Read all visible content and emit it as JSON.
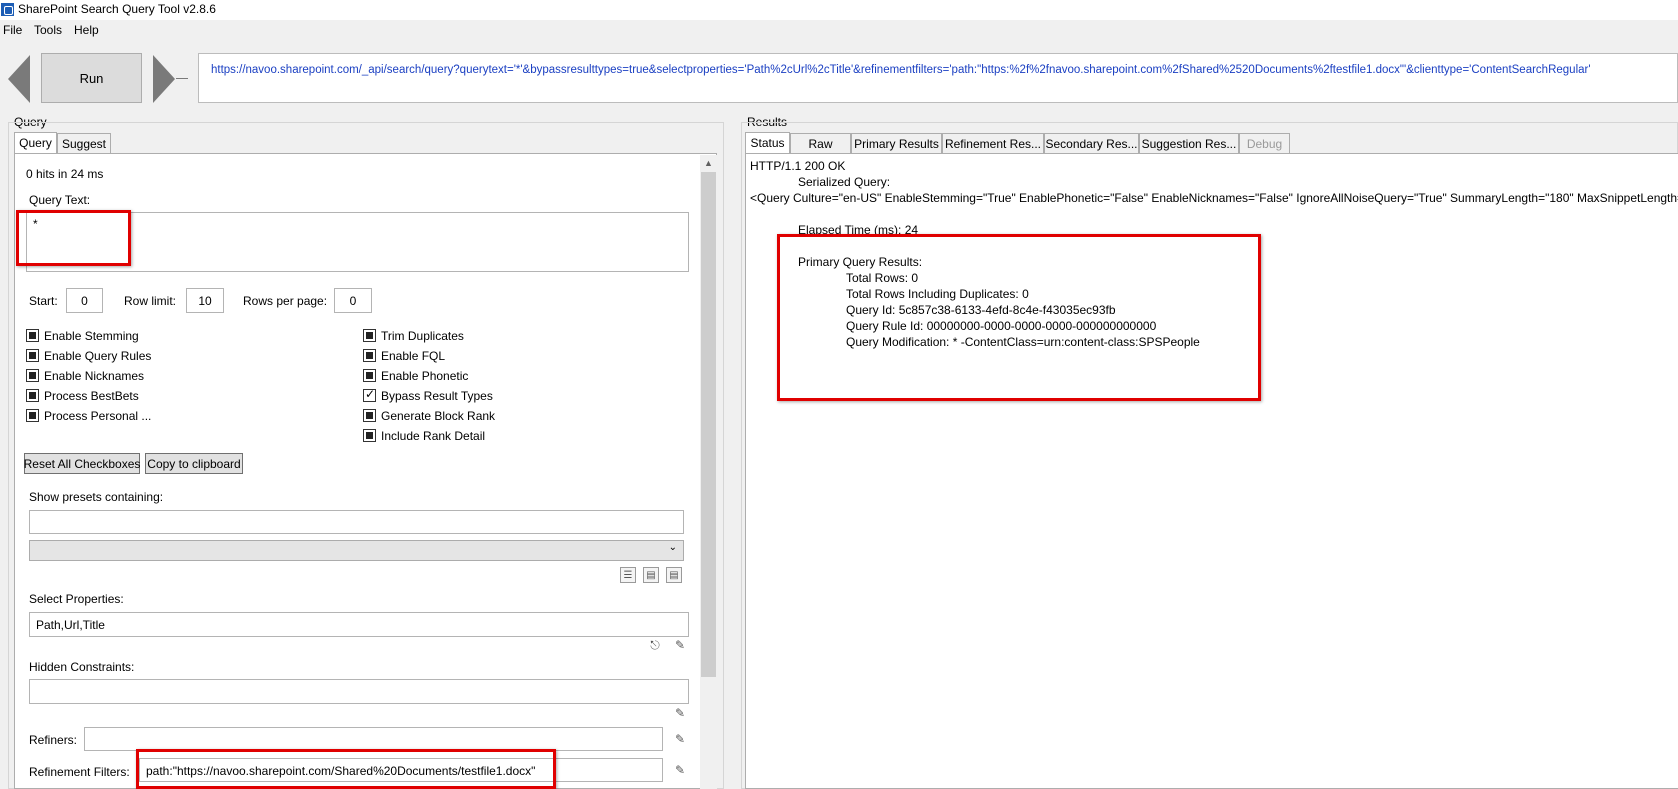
{
  "window": {
    "title": "SharePoint Search Query Tool v2.8.6"
  },
  "menu": {
    "items": [
      "File",
      "Tools",
      "Help"
    ]
  },
  "toolbar": {
    "run_label": "Run",
    "url": "https://navoo.sharepoint.com/_api/search/query?querytext='*'&bypassresulttypes=true&selectproperties='Path%2cUrl%2cTitle'&refinementfilters='path:\"https:%2f%2fnavoo.sharepoint.com%2fShared%2520Documents%2ftestfile1.docx\"'&clienttype='ContentSearchRegular'"
  },
  "query": {
    "group_label": "Query",
    "tabs": [
      {
        "label": "Query",
        "active": true
      },
      {
        "label": "Suggest",
        "active": false
      }
    ],
    "hits_text": "0 hits in 24 ms",
    "query_text_label": "Query Text:",
    "query_text_value": "*",
    "start_label": "Start:",
    "start_value": "0",
    "row_limit_label": "Row limit:",
    "row_limit_value": "10",
    "rows_per_page_label": "Rows per page:",
    "rows_per_page_value": "0",
    "checkboxes_left": [
      {
        "label": "Enable Stemming",
        "state": "indeterminate"
      },
      {
        "label": "Enable Query Rules",
        "state": "indeterminate"
      },
      {
        "label": "Enable Nicknames",
        "state": "indeterminate"
      },
      {
        "label": "Process BestBets",
        "state": "indeterminate"
      },
      {
        "label": "Process Personal ...",
        "state": "indeterminate"
      }
    ],
    "checkboxes_right": [
      {
        "label": "Trim Duplicates",
        "state": "indeterminate"
      },
      {
        "label": "Enable FQL",
        "state": "indeterminate"
      },
      {
        "label": "Enable Phonetic",
        "state": "indeterminate"
      },
      {
        "label": "Bypass Result Types",
        "state": "checked"
      },
      {
        "label": "Generate Block Rank",
        "state": "indeterminate"
      },
      {
        "label": "Include Rank Detail",
        "state": "indeterminate"
      }
    ],
    "reset_button": "Reset All Checkboxes",
    "copy_button": "Copy to clipboard",
    "presets_label": "Show presets containing:",
    "presets_value": "",
    "select_properties_label": "Select Properties:",
    "select_properties_value": "Path,Url,Title",
    "hidden_constraints_label": "Hidden Constraints:",
    "hidden_constraints_value": "",
    "refiners_label": "Refiners:",
    "refiners_value": "",
    "refinement_filters_label": "Refinement Filters:",
    "refinement_filters_value": "path:\"https://navoo.sharepoint.com/Shared%20Documents/testfile1.docx\""
  },
  "results": {
    "group_label": "Results",
    "tabs": [
      {
        "label": "Status",
        "active": true,
        "enabled": true
      },
      {
        "label": "Raw",
        "active": false,
        "enabled": true
      },
      {
        "label": "Primary Results",
        "active": false,
        "enabled": true
      },
      {
        "label": "Refinement Res...",
        "active": false,
        "enabled": true
      },
      {
        "label": "Secondary Res...",
        "active": false,
        "enabled": true
      },
      {
        "label": "Suggestion Res...",
        "active": false,
        "enabled": true
      },
      {
        "label": "Debug",
        "active": false,
        "enabled": false
      }
    ],
    "status": {
      "http": "HTTP/1.1 200 OK",
      "serialized_query_label": "Serialized Query:",
      "serialized_query": "<Query Culture=\"en-US\" EnableStemming=\"True\" EnablePhonetic=\"False\" EnableNicknames=\"False\" IgnoreAllNoiseQuery=\"True\" SummaryLength=\"180\" MaxSnippetLength=\"",
      "elapsed_time": "Elapsed Time (ms): 24",
      "primary_results_label": "Primary Query Results:",
      "total_rows": "Total Rows: 0",
      "total_rows_dup": "Total Rows Including Duplicates: 0",
      "query_id": "Query Id: 5c857c38-6133-4efd-8c4e-f43035ec93fb",
      "query_rule_id": "Query Rule Id: 00000000-0000-0000-0000-000000000000",
      "query_modification": "Query Modification: * -ContentClass=urn:content-class:SPSPeople"
    }
  },
  "colors": {
    "url_text": "#1a3fc2",
    "highlight": "#e00000",
    "window_bg": "#f0f0f0"
  }
}
